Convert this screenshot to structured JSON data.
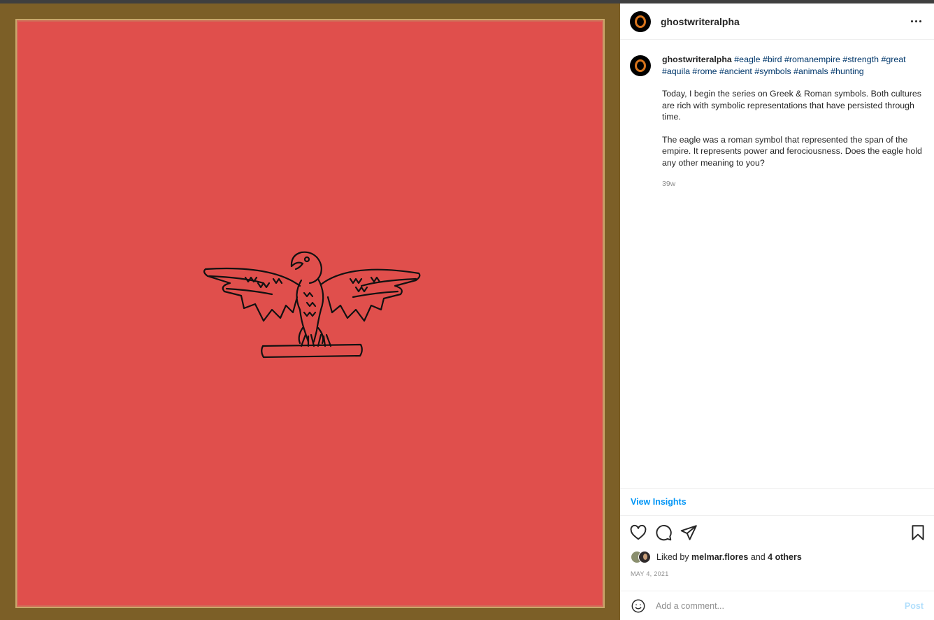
{
  "post": {
    "username": "ghostwriteralpha",
    "caption": {
      "username": "ghostwriteralpha",
      "hashtags": [
        "#eagle",
        "#bird",
        "#romanempire",
        "#strength",
        "#great",
        "#aquila",
        "#rome",
        "#ancient",
        "#symbols",
        "#animals",
        "#hunting"
      ],
      "paragraph1": "Today, I begin the series on Greek & Roman symbols. Both cultures are rich with symbolic representations that have persisted through time.",
      "paragraph2": "The eagle was a roman symbol that represented the span of the empire. It represents power and ferociousness. Does the eagle hold any other meaning to you?",
      "age": "39w"
    },
    "view_insights_label": "View Insights",
    "likes": {
      "prefix": "Liked by",
      "user": "melmar.flores",
      "conjunction": "and",
      "others": "4 others"
    },
    "date": "MAY 4, 2021",
    "comment": {
      "placeholder": "Add a comment...",
      "post_label": "Post"
    }
  },
  "icons": [
    "more-options-icon",
    "heart-icon",
    "comment-icon",
    "share-icon",
    "save-bookmark-icon",
    "emoji-icon",
    "roman-eagle-drawing"
  ],
  "colors": {
    "image_background": "#e04f4c",
    "image_frame": "#7c5f27",
    "link_blue": "#0095f6",
    "hashtag_blue": "#00376b",
    "post_disabled": "#b2dffc"
  }
}
